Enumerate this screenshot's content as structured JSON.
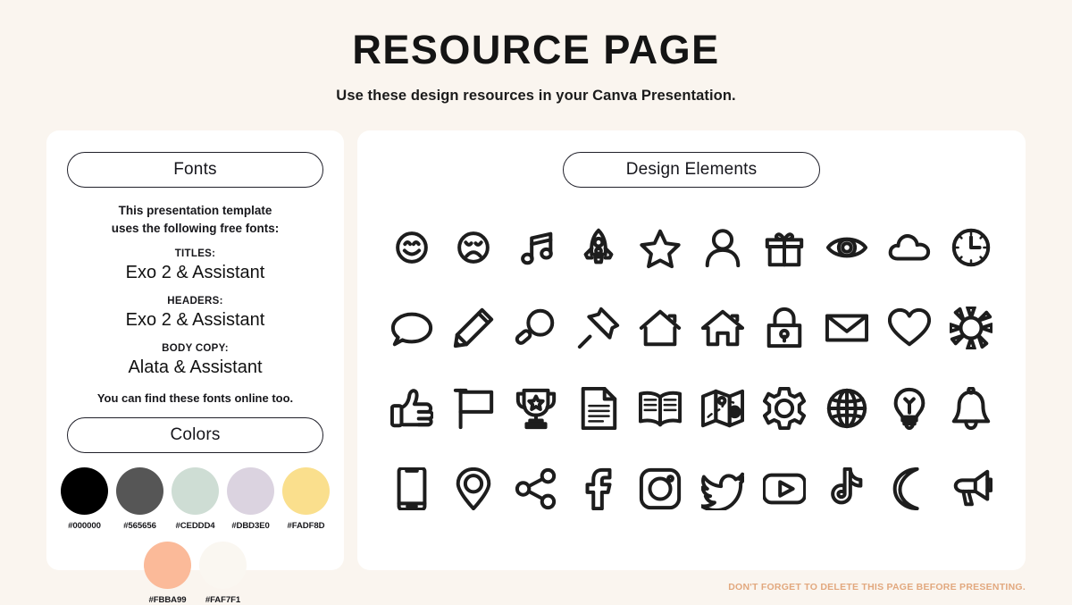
{
  "header": {
    "title": "RESOURCE PAGE",
    "subtitle": "Use these design resources in your Canva Presentation."
  },
  "fonts_panel": {
    "heading": "Fonts",
    "intro_line1": "This presentation template",
    "intro_line2": "uses the following free fonts:",
    "groups": [
      {
        "role": "TITLES:",
        "name": "Exo 2 & Assistant"
      },
      {
        "role": "HEADERS:",
        "name": "Exo 2 & Assistant"
      },
      {
        "role": "BODY COPY:",
        "name": "Alata & Assistant"
      }
    ],
    "outro": "You can find these fonts online too."
  },
  "colors_panel": {
    "heading": "Colors",
    "row1": [
      {
        "hex": "#000000",
        "label": "#000000"
      },
      {
        "hex": "#565656",
        "label": "#565656"
      },
      {
        "hex": "#CEDDD4",
        "label": "#CEDDD4"
      },
      {
        "hex": "#DBD3E0",
        "label": "#DBD3E0"
      },
      {
        "hex": "#FADF8D",
        "label": "#FADF8D"
      }
    ],
    "row2": [
      {
        "hex": "#FBBA99",
        "label": "#FBBA99"
      },
      {
        "hex": "#FAF7F1",
        "label": "#FAF7F1"
      }
    ]
  },
  "elements_panel": {
    "heading": "Design Elements",
    "icons": [
      "smiley-face-icon",
      "sad-face-icon",
      "music-note-icon",
      "rocket-icon",
      "star-icon",
      "user-icon",
      "gift-icon",
      "eye-icon",
      "cloud-icon",
      "clock-icon",
      "speech-bubble-icon",
      "pencil-icon",
      "magnifying-glass-icon",
      "pushpin-icon",
      "house-icon",
      "home-icon",
      "lock-icon",
      "envelope-icon",
      "heart-icon",
      "sun-icon",
      "thumbs-up-icon",
      "flag-icon",
      "trophy-icon",
      "document-icon",
      "open-book-icon",
      "map-icon",
      "gear-icon",
      "globe-icon",
      "lightbulb-icon",
      "bell-icon",
      "smartphone-icon",
      "location-pin-icon",
      "share-icon",
      "facebook-icon",
      "instagram-icon",
      "twitter-icon",
      "youtube-icon",
      "tiktok-icon",
      "moon-icon",
      "megaphone-icon"
    ]
  },
  "footer": {
    "note": "DON'T FORGET TO DELETE THIS PAGE BEFORE PRESENTING.",
    "note_color": "#E2A87E"
  }
}
